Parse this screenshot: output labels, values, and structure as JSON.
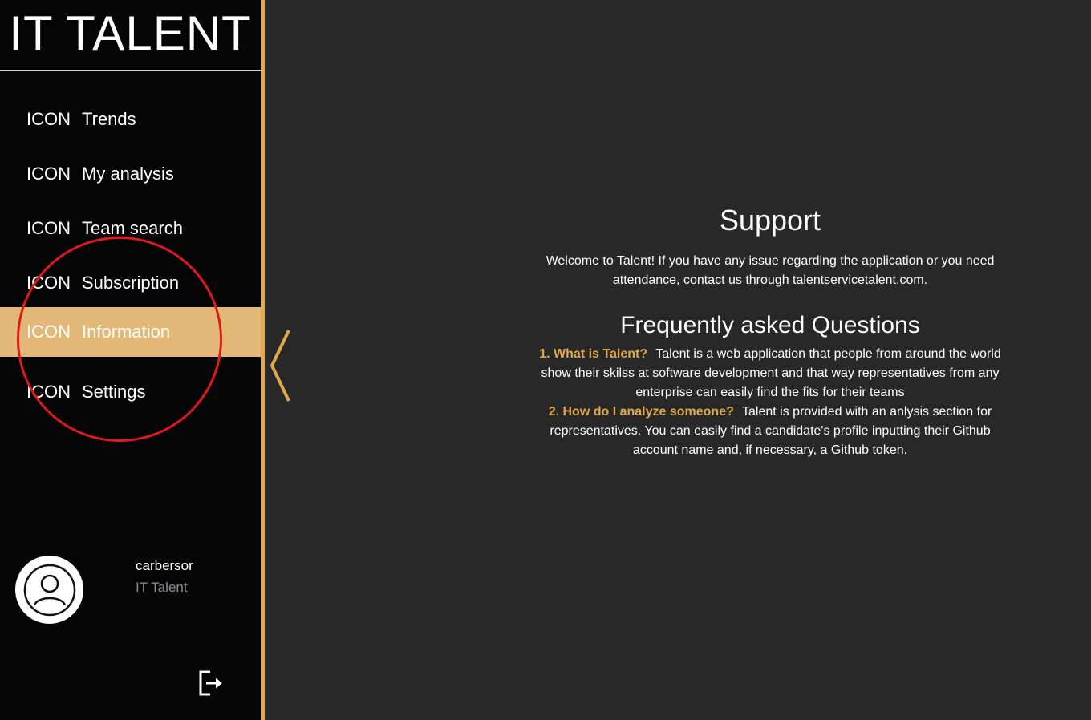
{
  "brand": "IT TALENT",
  "nav": [
    {
      "icon": "ICON",
      "label": "Trends"
    },
    {
      "icon": "ICON",
      "label": "My analysis"
    },
    {
      "icon": "ICON",
      "label": "Team search"
    },
    {
      "icon": "ICON",
      "label": "Subscription"
    },
    {
      "icon": "ICON",
      "label": "Information"
    },
    {
      "icon": "ICON",
      "label": "Settings"
    }
  ],
  "user": {
    "name": "carbersor",
    "org": "IT Talent"
  },
  "support": {
    "title": "Support",
    "text": "Welcome to Talent! If you have any issue regarding the application or you need attendance, contact us through talentservicetalent.com."
  },
  "faq": {
    "title": "Frequently asked Questions",
    "items": [
      {
        "question": "1. What is Talent?",
        "answer": "Talent is a web application that people from around the world show their skilss at software development and that way representatives from any enterprise can easily find the fits for their teams"
      },
      {
        "question": "2. How do I analyze someone?",
        "answer": "Talent is provided with an anlysis section for representatives. You can easily find a candidate's profile inputting their Github account name and, if necessary, a Github token."
      }
    ]
  },
  "colors": {
    "accent": "#e0a84a",
    "active_bg": "#e3b877",
    "sidebar_bg": "#050505",
    "content_bg": "#282828"
  },
  "icons": {
    "avatar": "user-avatar-icon",
    "logout": "logout-icon",
    "toggle": "chevron-left-icon"
  }
}
